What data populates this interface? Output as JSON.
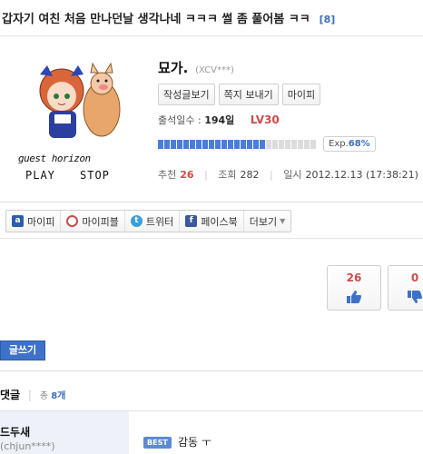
{
  "post": {
    "title": "갑자기 여친 처음 만나던날 생각나네 ㅋㅋㅋ 썰 좀 풀어봄 ㅋㅋ",
    "comment_count": "[8]"
  },
  "author": {
    "avatar_caption": "guest horizon",
    "play_label": "PLAY",
    "stop_label": "STOP",
    "nickname": "묘가.",
    "user_id": "(XCV***)",
    "buttons": [
      "작성글보기",
      "쪽지 보내기",
      "마이피"
    ],
    "attendance_label": "출석일수 :",
    "attendance_days": "194일",
    "level": "LV30",
    "exp_label": "Exp.",
    "exp_value": "68%",
    "exp_fraction": 0.68
  },
  "stats": {
    "recommend_label": "추천",
    "recommend_value": "26",
    "views_label": "조회",
    "views_value": "282",
    "date_label": "일시",
    "date_value": "2012.12.13 (17:38:21)"
  },
  "share": {
    "items": [
      {
        "label": "마이피",
        "icon": "mypi-icon"
      },
      {
        "label": "마이피블",
        "icon": "mypi-blog-icon"
      },
      {
        "label": "트위터",
        "icon": "twitter-icon"
      },
      {
        "label": "페이스북",
        "icon": "facebook-icon"
      }
    ],
    "more_label": "더보기"
  },
  "votes": {
    "up": "26",
    "down": "0"
  },
  "write_button": "글쓰기",
  "comments": {
    "label": "댓글",
    "total_label": "총",
    "total_value": "8개",
    "first": {
      "name": "드두새",
      "id": "(chjun****)",
      "badge": "BEST",
      "text": "감동 ㅜ"
    }
  },
  "colors": {
    "accent": "#3d72c8",
    "level_red": "#d04a4a",
    "exp_fill": "#4a7fd0"
  }
}
